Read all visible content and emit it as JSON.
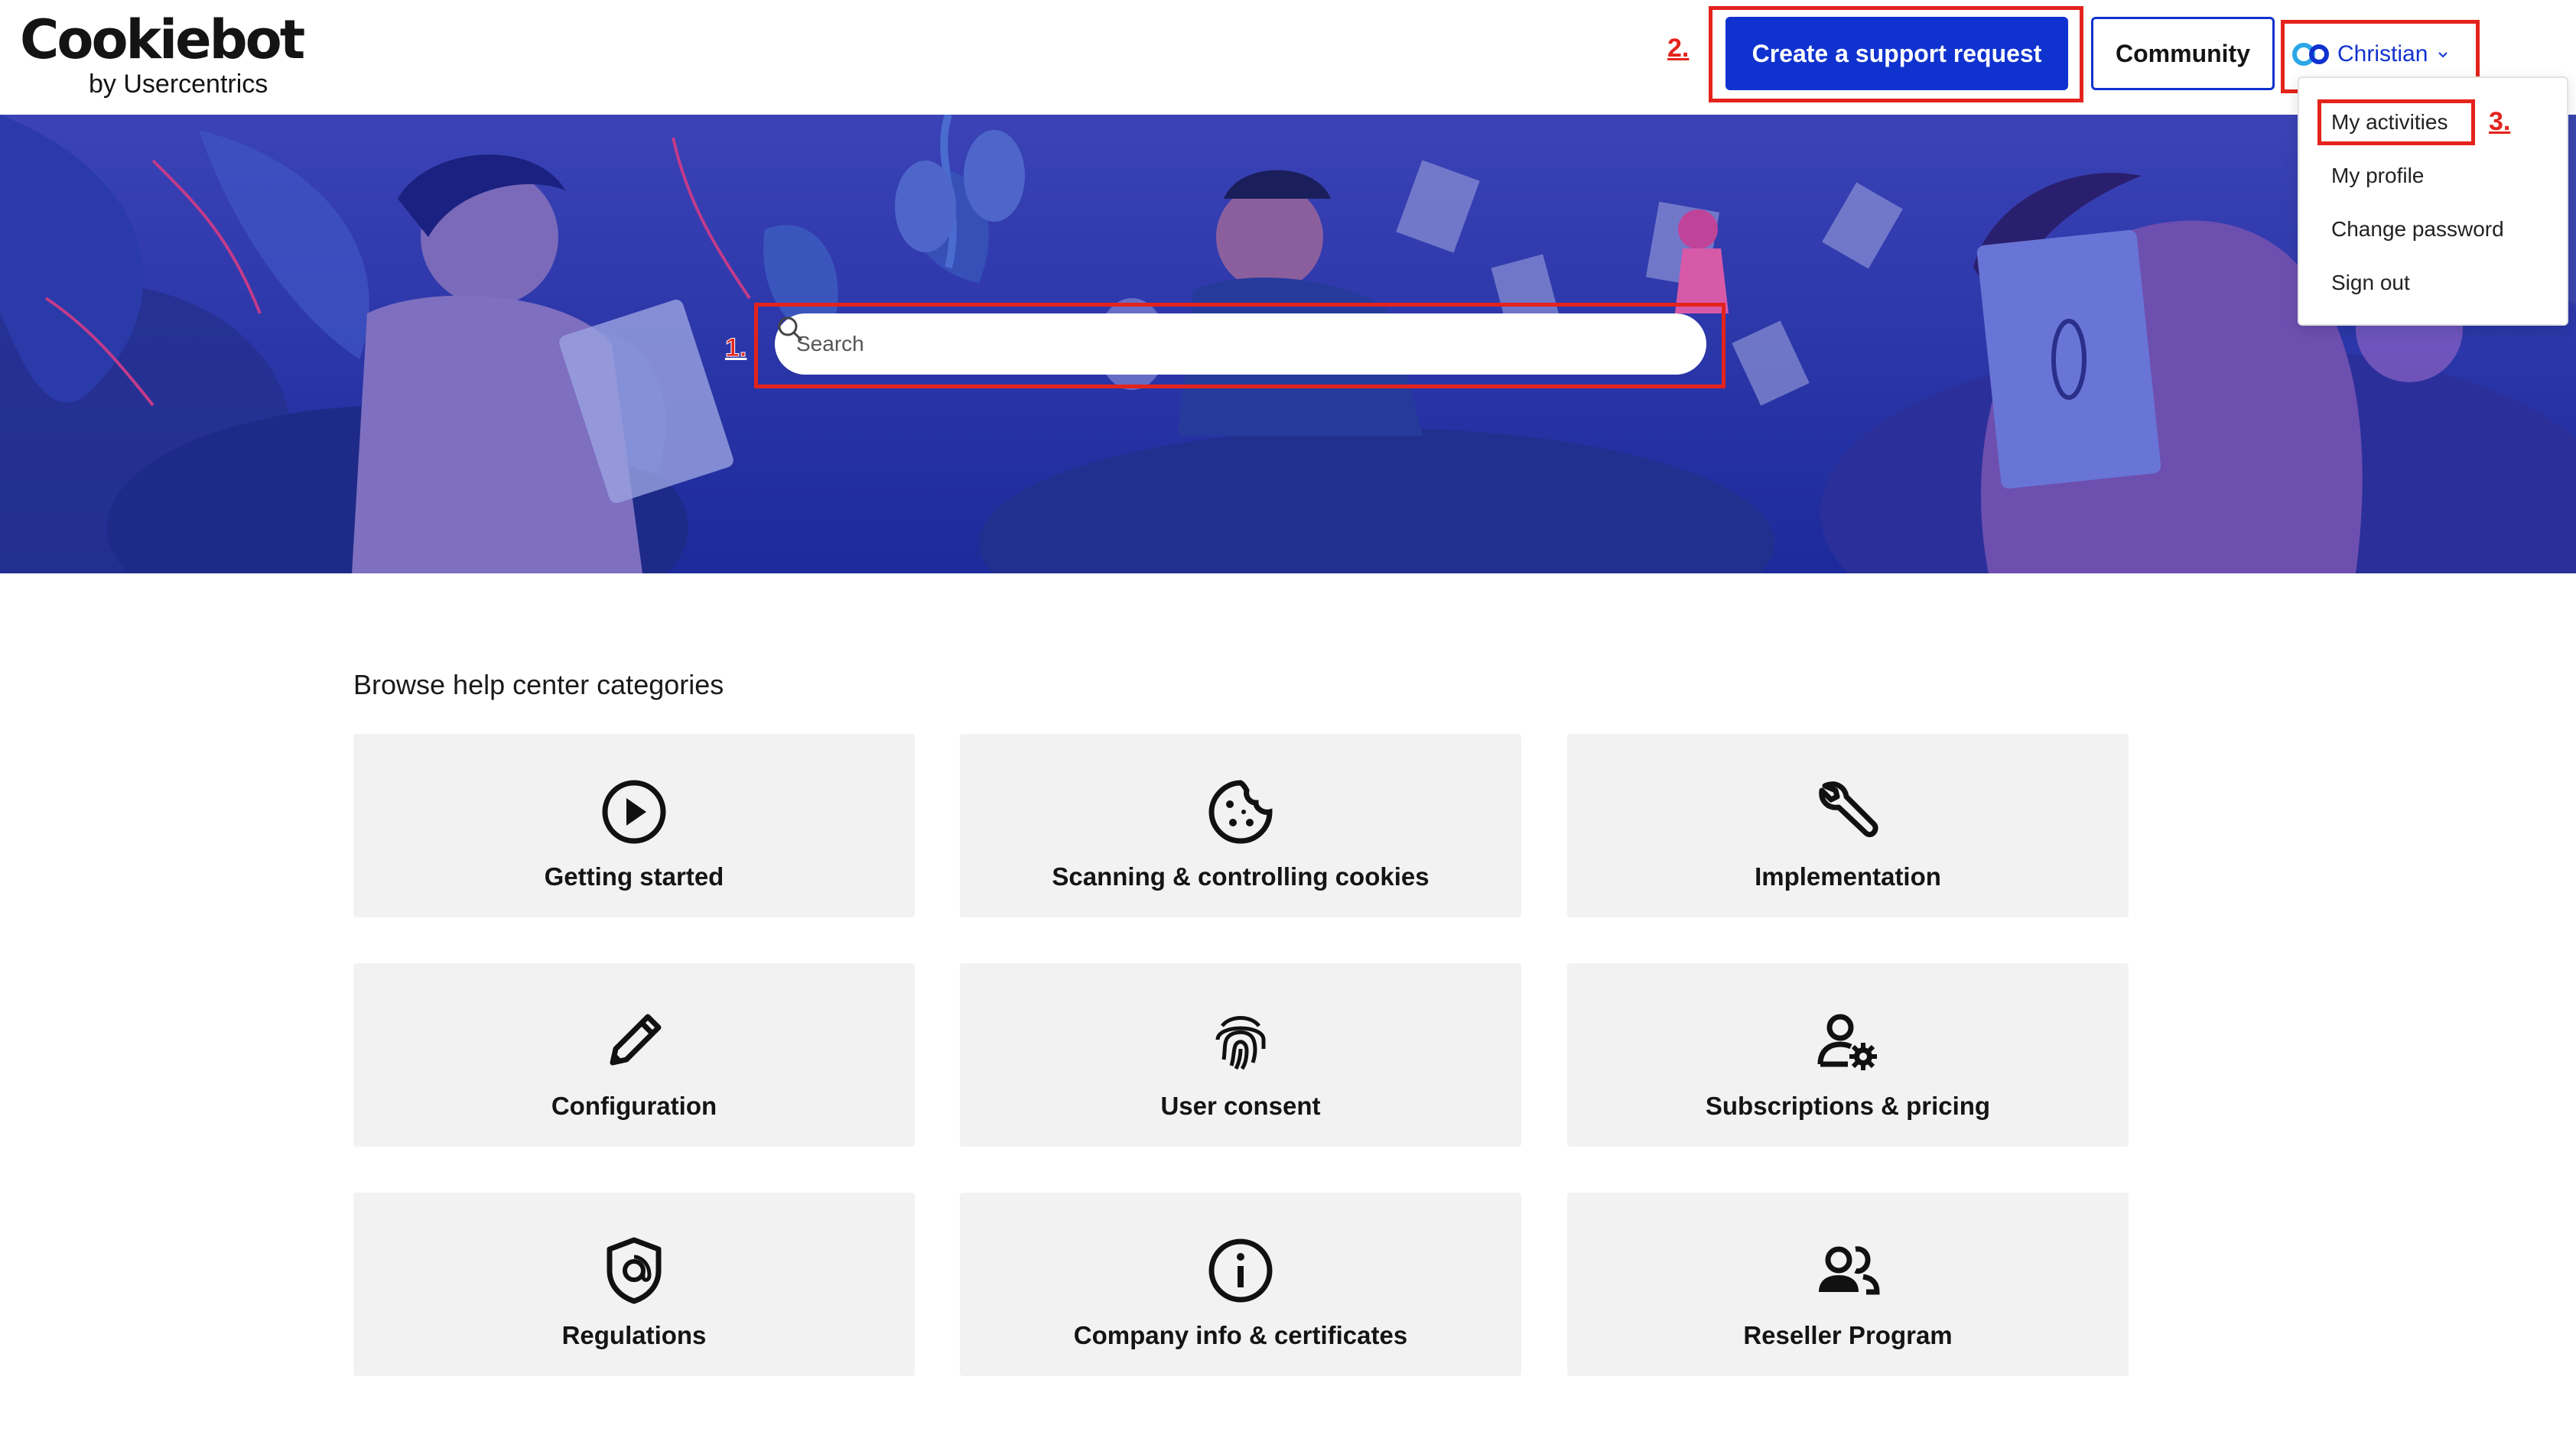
{
  "header": {
    "logo_main": "Cookiebot",
    "logo_sub": "by Usercentrics",
    "support_button": "Create a support request",
    "community_button": "Community",
    "user_name": "Christian"
  },
  "user_dropdown": {
    "items": [
      {
        "label": "My activities"
      },
      {
        "label": "My profile"
      },
      {
        "label": "Change password"
      },
      {
        "label": "Sign out"
      }
    ]
  },
  "annotations": {
    "step1": "1.",
    "step2": "2.",
    "step3": "3.",
    "color": "#e4231c"
  },
  "search": {
    "placeholder": "Search"
  },
  "categories": {
    "title": "Browse help center categories",
    "items": [
      {
        "label": "Getting started",
        "icon": "play-circle-icon"
      },
      {
        "label": "Scanning & controlling cookies",
        "icon": "cookie-icon"
      },
      {
        "label": "Implementation",
        "icon": "wrench-icon"
      },
      {
        "label": "Configuration",
        "icon": "pencil-icon"
      },
      {
        "label": "User consent",
        "icon": "fingerprint-icon"
      },
      {
        "label": "Subscriptions & pricing",
        "icon": "user-gear-icon"
      },
      {
        "label": "Regulations",
        "icon": "shield-icon"
      },
      {
        "label": "Company info & certificates",
        "icon": "info-circle-icon"
      },
      {
        "label": "Reseller Program",
        "icon": "users-icon"
      }
    ]
  },
  "colors": {
    "brand_blue": "#1032cf",
    "hero_blue": "#2d3aa8",
    "card_bg": "#f2f2f2"
  }
}
